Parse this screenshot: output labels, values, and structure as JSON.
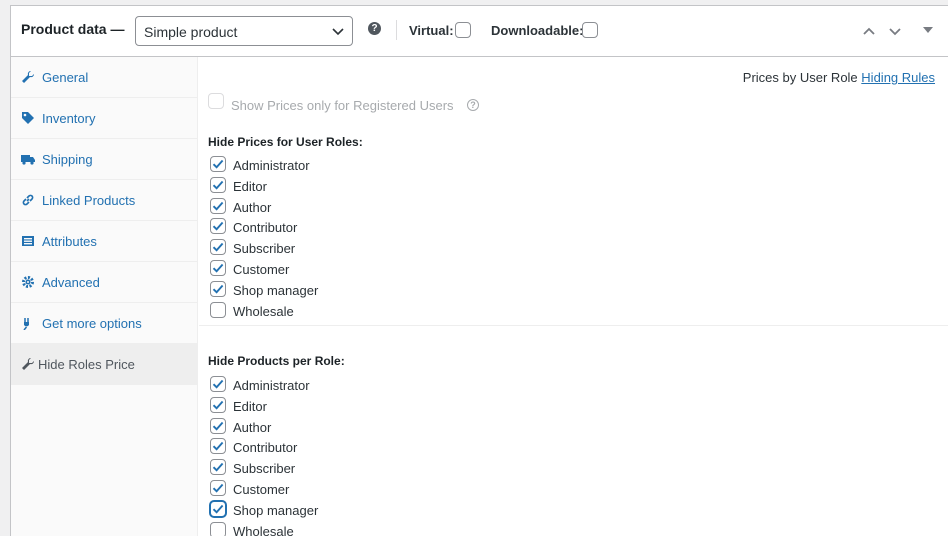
{
  "header": {
    "title": "Product data —",
    "product_type": "Simple product",
    "help_glyph": "?",
    "virtual_label": "Virtual:",
    "downloadable_label": "Downloadable:"
  },
  "sidebar": {
    "items": [
      {
        "label": "General",
        "icon": "wrench-icon"
      },
      {
        "label": "Inventory",
        "icon": "tag-icon"
      },
      {
        "label": "Shipping",
        "icon": "truck-icon"
      },
      {
        "label": "Linked Products",
        "icon": "link-icon"
      },
      {
        "label": "Attributes",
        "icon": "list-icon"
      },
      {
        "label": "Advanced",
        "icon": "gear-icon"
      },
      {
        "label": "Get more options",
        "icon": "plugin-icon"
      },
      {
        "label": "Hide Roles Price",
        "icon": "wrench-icon",
        "active": true
      }
    ]
  },
  "main": {
    "top_text": "Prices by User Role",
    "top_link": "Hiding Rules",
    "registered_label": "Show Prices only for Registered Users",
    "hide_prices": {
      "title": "Hide Prices for User Roles:",
      "roles": [
        {
          "label": "Administrator",
          "checked": true
        },
        {
          "label": "Editor",
          "checked": true
        },
        {
          "label": "Author",
          "checked": true
        },
        {
          "label": "Contributor",
          "checked": true
        },
        {
          "label": "Subscriber",
          "checked": true
        },
        {
          "label": "Customer",
          "checked": true
        },
        {
          "label": "Shop manager",
          "checked": true
        },
        {
          "label": "Wholesale",
          "checked": false
        }
      ]
    },
    "hide_products": {
      "title": "Hide Products per Role:",
      "roles": [
        {
          "label": "Administrator",
          "checked": true
        },
        {
          "label": "Editor",
          "checked": true
        },
        {
          "label": "Author",
          "checked": true
        },
        {
          "label": "Contributor",
          "checked": true
        },
        {
          "label": "Subscriber",
          "checked": true
        },
        {
          "label": "Customer",
          "checked": true
        },
        {
          "label": "Shop manager",
          "checked": true
        },
        {
          "label": "Wholesale",
          "checked": false
        }
      ]
    }
  },
  "colors": {
    "link": "#2271b1",
    "check": "#2271b1",
    "muted": "#a7aaad"
  }
}
